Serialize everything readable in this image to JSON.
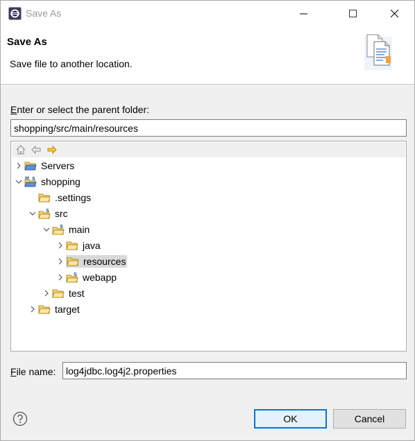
{
  "window": {
    "title": "Save As",
    "minimize_icon": "minimize-icon",
    "maximize_icon": "maximize-icon",
    "close_icon": "close-icon"
  },
  "banner": {
    "title": "Save As",
    "description": "Save file to another location.",
    "icon": "documents-icon"
  },
  "folder": {
    "label_prefix": "",
    "label_mnemonic": "E",
    "label_rest": "nter or select the parent folder:",
    "value": "shopping/src/main/resources"
  },
  "tree": {
    "toolbar_icons": [
      "home-icon",
      "back-arrow-icon",
      "forward-arrow-icon"
    ],
    "nodes": [
      {
        "label": "Servers",
        "expanded": false
      },
      {
        "label": "shopping",
        "expanded": true
      },
      {
        "label": ".settings",
        "expanded": null
      },
      {
        "label": "src",
        "expanded": true
      },
      {
        "label": "main",
        "expanded": true
      },
      {
        "label": "java",
        "expanded": false
      },
      {
        "label": "resources",
        "expanded": false,
        "selected": true
      },
      {
        "label": "webapp",
        "expanded": false
      },
      {
        "label": "test",
        "expanded": false
      },
      {
        "label": "target",
        "expanded": false
      }
    ]
  },
  "filename": {
    "label_mnemonic": "F",
    "label_rest": "ile name:",
    "value": "log4jdbc.log4j2.properties"
  },
  "buttons": {
    "ok": "OK",
    "cancel": "Cancel",
    "help_icon": "help-icon"
  },
  "colors": {
    "accent": "#0078d7",
    "folder": "#e8b84a",
    "selected_row": "#d9d9d9"
  }
}
